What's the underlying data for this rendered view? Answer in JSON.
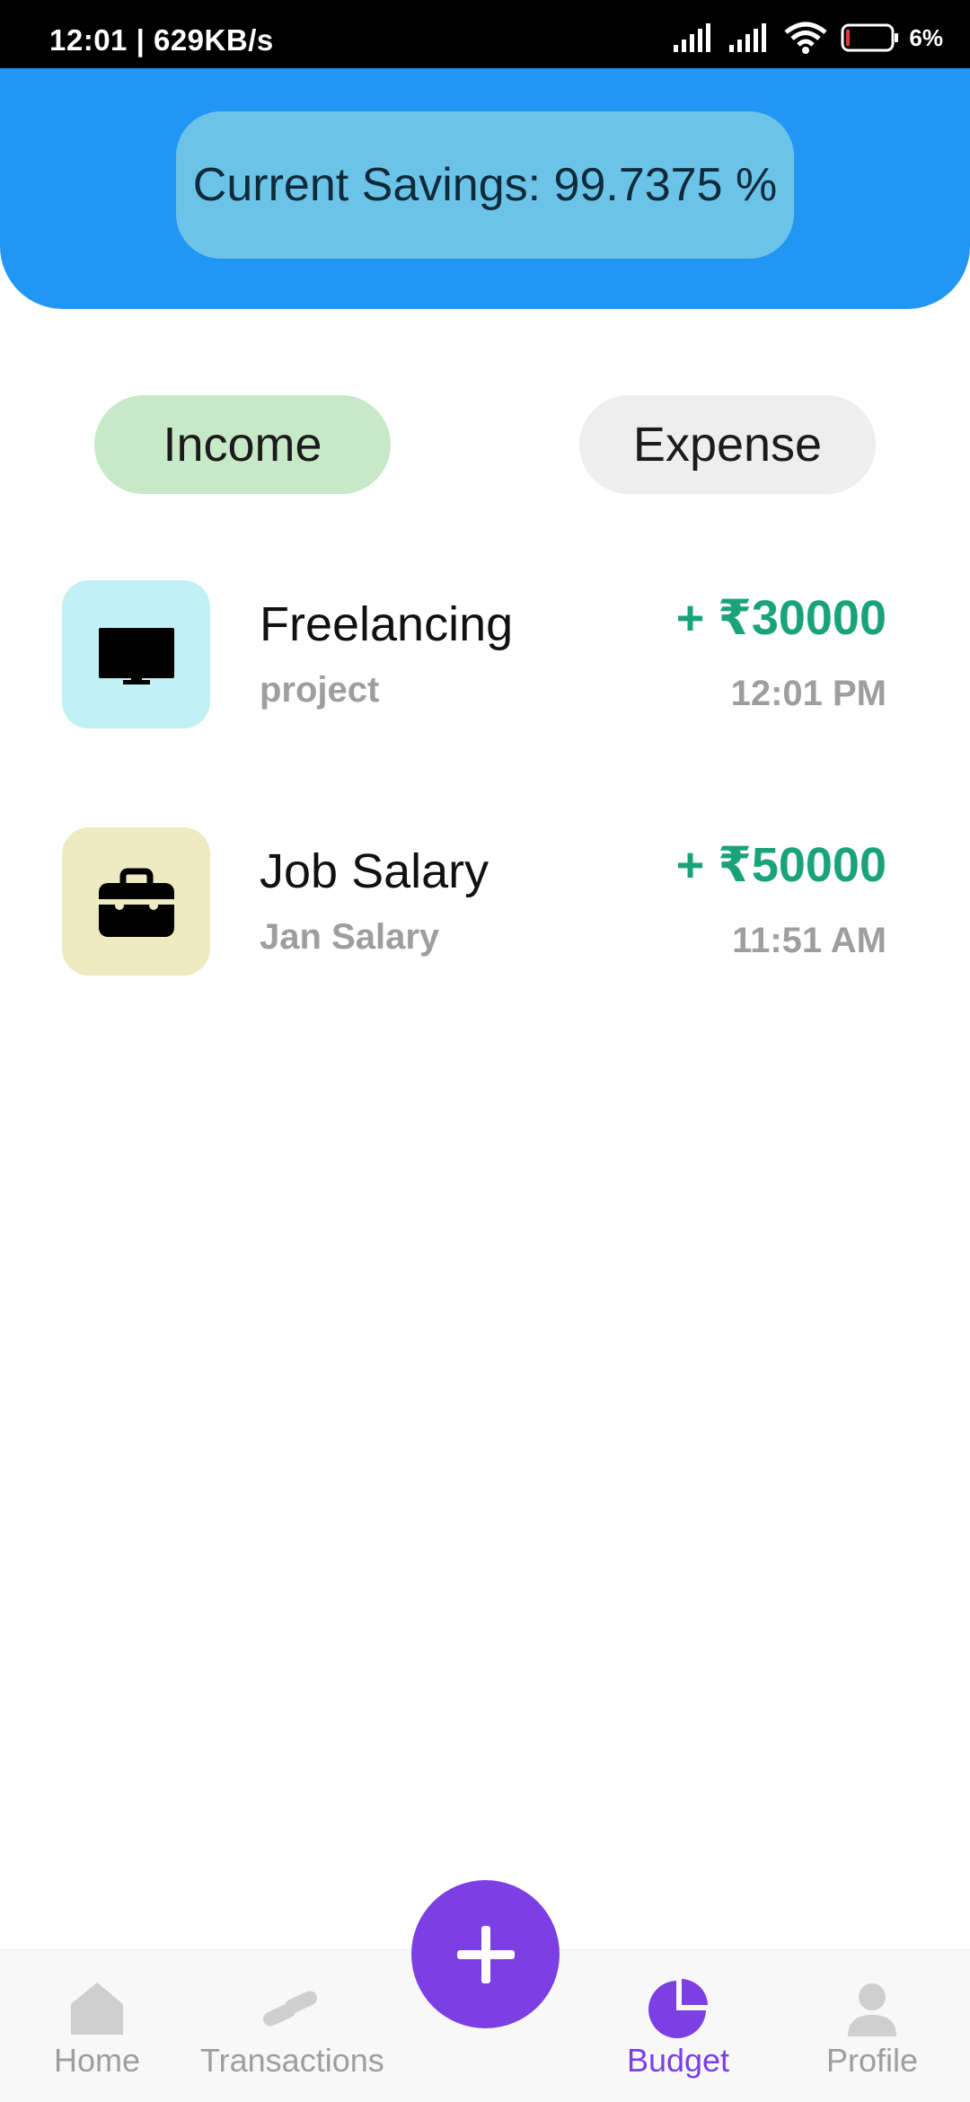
{
  "status_bar": {
    "time_speed": "12:01 | 629KB/s",
    "battery_percent": "6%",
    "icons": [
      "signal-icon",
      "signal-icon",
      "wifi-icon",
      "battery-icon"
    ]
  },
  "header": {
    "savings_text": "Current Savings: 99.7375 %"
  },
  "tabs": [
    {
      "label": "Income",
      "active": true
    },
    {
      "label": "Expense",
      "active": false
    }
  ],
  "transactions": [
    {
      "icon": "monitor-icon",
      "icon_bg": "#c1f0f5",
      "title": "Freelancing",
      "subtitle": "project",
      "amount": "+ ₹30000",
      "time": "12:01 PM"
    },
    {
      "icon": "briefcase-icon",
      "icon_bg": "#efeac1",
      "title": "Job Salary",
      "subtitle": "Jan Salary",
      "amount": "+ ₹50000",
      "time": "11:51 AM"
    }
  ],
  "bottom_nav": {
    "items": [
      {
        "label": "Home",
        "icon": "home-icon",
        "active": false
      },
      {
        "label": "Transactions",
        "icon": "transactions-icon",
        "active": false
      },
      {
        "label": "Budget",
        "icon": "pie-chart-icon",
        "active": true
      },
      {
        "label": "Profile",
        "icon": "profile-icon",
        "active": false
      }
    ],
    "fab_icon": "plus-icon"
  },
  "colors": {
    "header": "#2196f3",
    "savings_pill": "#6cc3e8",
    "income_tab": "#c8e9c8",
    "expense_tab": "#eeeeee",
    "amount_green": "#1aa37a",
    "accent_purple": "#7b3fe4"
  }
}
